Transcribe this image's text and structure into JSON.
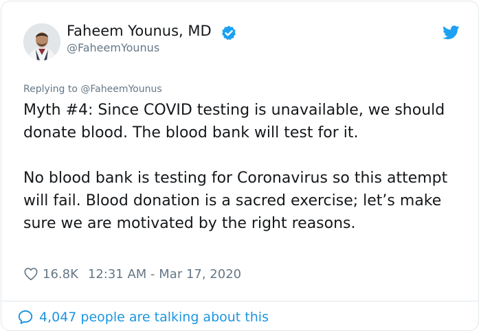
{
  "author": {
    "name": "Faheem Younus, MD",
    "handle": "@FaheemYounus"
  },
  "tweet": {
    "replying_to_prefix": "Replying to ",
    "replying_to_handle": "@FaheemYounus",
    "paragraph_1": "Myth #4: Since COVID testing is unavailable, we should donate blood. The blood bank will test for it.",
    "paragraph_2": "No blood bank is testing for Coronavirus so this attempt will fail. Blood donation is a sacred exercise; let’s make sure we are motivated by the right reasons.",
    "likes": "16.8K",
    "timestamp": "12:31 AM - Mar 17, 2020"
  },
  "footer": {
    "talking_text": "4,047 people are talking about this"
  },
  "icons": {
    "verified": "verified-badge-icon",
    "twitter": "twitter-bird-icon",
    "like": "heart-outline-icon",
    "reply": "speech-bubble-icon"
  },
  "colors": {
    "accent": "#1da1f2",
    "link": "#1b95e0",
    "muted": "#657786",
    "text": "#14171a",
    "border": "#e1e8ed"
  }
}
